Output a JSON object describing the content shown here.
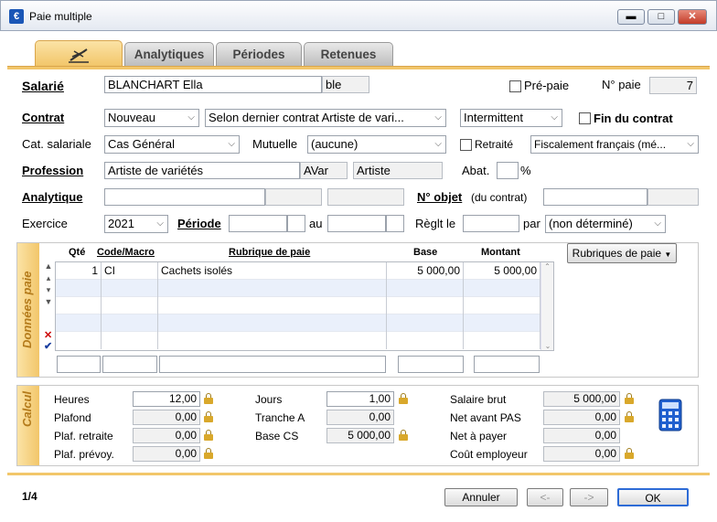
{
  "window": {
    "title": "Paie multiple"
  },
  "tabs": [
    {
      "label": ""
    },
    {
      "label": "Analytiques"
    },
    {
      "label": "Périodes"
    },
    {
      "label": "Retenues"
    }
  ],
  "header": {
    "salarie_label": "Salarié",
    "salarie_name": "BLANCHART Ella",
    "salarie_code": "ble",
    "prepaie_label": "Pré-paie",
    "npaie_label": "N° paie",
    "npaie_value": "7",
    "contrat_label": "Contrat",
    "contrat_value": "Nouveau",
    "contrat_mode": "Selon dernier contrat Artiste de vari...",
    "contrat_type": "Intermittent",
    "fin_contrat_label": "Fin du contrat",
    "cat_label": "Cat. salariale",
    "cat_value": "Cas Général",
    "mutuelle_label": "Mutuelle",
    "mutuelle_value": "(aucune)",
    "retraite_label": "Retraité",
    "fiscal_value": "Fiscalement français (mé...",
    "profession_label": "Profession",
    "profession_value": "Artiste de variétés",
    "profession_code": "AVar",
    "profession_short": "Artiste",
    "abat_label": "Abat.",
    "percent": "%",
    "analytique_label": "Analytique",
    "nobjet_label": "N° objet",
    "nobjet_sub": "(du contrat)",
    "exercice_label": "Exercice",
    "exercice_value": "2021",
    "periode_label": "Période",
    "au_label": "au",
    "reglt_label": "Règlt le",
    "par_label": "par",
    "par_value": "(non déterminé)"
  },
  "donnees": {
    "side_label": "Données paie",
    "columns": {
      "qte": "Qté",
      "code": "Code/Macro",
      "rubrique": "Rubrique de paie",
      "base": "Base",
      "montant": "Montant"
    },
    "rows": [
      {
        "qte": "1",
        "code": "CI",
        "rubrique": "Cachets isolés",
        "base": "5 000,00",
        "montant": "5 000,00"
      }
    ],
    "rubriques_button": "Rubriques de paie"
  },
  "calcul": {
    "side_label": "Calcul",
    "heures_label": "Heures",
    "heures_value": "12,00",
    "plafond_label": "Plafond",
    "plafond_value": "0,00",
    "plaf_retraite_label": "Plaf. retraite",
    "plaf_retraite_value": "0,00",
    "plaf_prevoy_label": "Plaf. prévoy.",
    "plaf_prevoy_value": "0,00",
    "jours_label": "Jours",
    "jours_value": "1,00",
    "tranche_label": "Tranche A",
    "tranche_value": "0,00",
    "basecs_label": "Base CS",
    "basecs_value": "5 000,00",
    "brut_label": "Salaire brut",
    "brut_value": "5 000,00",
    "net_pas_label": "Net avant PAS",
    "net_pas_value": "0,00",
    "net_payer_label": "Net à payer",
    "net_payer_value": "0,00",
    "cout_label": "Coût employeur",
    "cout_value": "0,00"
  },
  "footer": {
    "page": "1/4",
    "annuler": "Annuler",
    "prev": "<-",
    "next": "->",
    "ok": "OK"
  }
}
